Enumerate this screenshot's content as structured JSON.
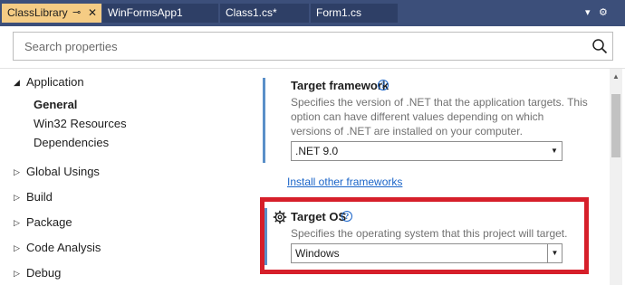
{
  "tabs": [
    {
      "label": "ClassLibrary",
      "active": true
    },
    {
      "label": "WinFormsApp1",
      "active": false
    },
    {
      "label": "Class1.cs*",
      "active": false
    },
    {
      "label": "Form1.cs",
      "active": false
    }
  ],
  "tab_controls": {
    "pin": "⊸",
    "close": "✕",
    "dropdown": "▾",
    "settings": "⚙"
  },
  "search": {
    "placeholder": "Search properties",
    "value": ""
  },
  "nav": {
    "application": {
      "label": "Application",
      "expanded": true
    },
    "children": [
      {
        "label": "General",
        "selected": true
      },
      {
        "label": "Win32 Resources",
        "selected": false
      },
      {
        "label": "Dependencies",
        "selected": false
      }
    ],
    "sections": [
      {
        "label": "Global Usings",
        "expanded": false
      },
      {
        "label": "Build",
        "expanded": false
      },
      {
        "label": "Package",
        "expanded": false
      },
      {
        "label": "Code Analysis",
        "expanded": false
      },
      {
        "label": "Debug",
        "expanded": false
      }
    ],
    "expanded_glyph": "◢",
    "collapsed_glyph": "▷"
  },
  "target_framework": {
    "title": "Target framework",
    "description_lines": [
      "Specifies the version of .NET that the application targets. This",
      "option can have different values depending on which",
      "versions of .NET are installed on your computer."
    ],
    "selected": ".NET 9.0",
    "install_link": "Install other frameworks"
  },
  "target_os": {
    "title": "Target OS",
    "description": "Specifies the operating system that this project will target.",
    "selected": "Windows"
  },
  "info_glyph": "?",
  "dropdown_glyph": "▼",
  "colors": {
    "tabstrip": "#3c4f7a",
    "active_tab": "#f5cc84",
    "accent_bar": "#5a8fc8",
    "link": "#1a64c8",
    "highlight": "#d61f2a"
  }
}
